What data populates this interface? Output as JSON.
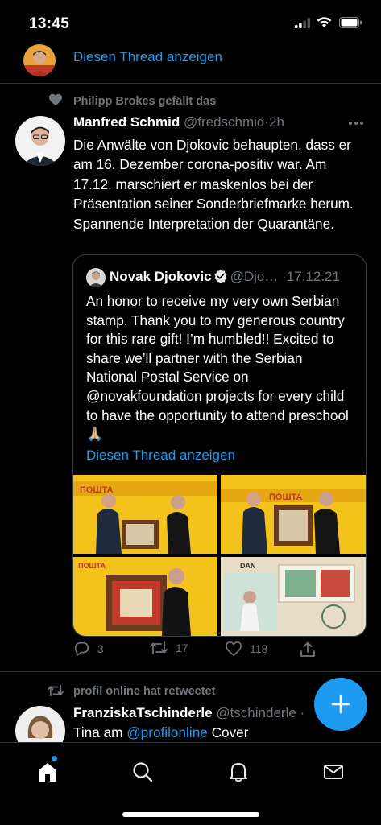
{
  "status_bar": {
    "time": "13:45"
  },
  "thread_link_top": "Diesen Thread anzeigen",
  "like_context": "Philipp Brokes gefällt das",
  "tweet": {
    "author_name": "Manfred Schmid",
    "handle": "@fredschmid",
    "separator": "·",
    "time": "2h",
    "text": "Die Anwälte von Djokovic behaupten, dass er am 16. Dezember corona-positiv war. Am 17.12. marschiert er maskenlos bei der Präsentation seiner Sonderbriefmarke herum. Spannende Interpretation der Quarantäne.",
    "quote": {
      "author_name": "Novak Djokovic",
      "handle": "@Djo…",
      "separator": "·",
      "date": "17.12.21",
      "text": "An honor to receive my very own Serbian stamp. Thank you to my generous country for this rare gift! I’m humbled!! Excited to share we’ll partner with the Serbian National Postal Service on @novakfoundation projects for every child to have the opportunity to attend preschool 🙏🏼",
      "thread_link": "Diesen Thread anzeigen",
      "photos": [
        {
          "label": "ПОШТА"
        },
        {
          "label": "ПОШТА"
        },
        {
          "label": "ПОШТА"
        },
        {
          "label": "DAN"
        }
      ]
    },
    "actions": {
      "replies": "3",
      "retweets": "17",
      "likes": "118"
    }
  },
  "retweet_context": "profil online hat retweetet",
  "tweet2": {
    "author_name": "FranziskaTschinderle",
    "handle": "@tschinderle",
    "separator": "·",
    "text_prefix": "Tina am ",
    "text_mention": "@profilonline",
    "text_suffix": " Cover"
  },
  "icons": {
    "like_context": "heart-icon",
    "more": "more-icon",
    "verified": "verified-icon",
    "reply": "reply-icon",
    "retweet": "retweet-icon",
    "like": "heart-icon",
    "share": "share-icon",
    "compose": "plus-icon",
    "nav": [
      "home-icon",
      "search-icon",
      "bell-icon",
      "mail-icon"
    ]
  },
  "colors": {
    "accent": "#1d9bf0",
    "background": "#000000",
    "muted": "#71767b"
  }
}
